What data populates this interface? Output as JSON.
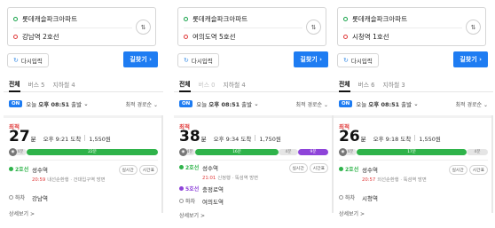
{
  "panels": [
    {
      "start": "롯데캐슬파크아파트",
      "end": "강남역 2호선",
      "reset_label": "다시입력",
      "go_label": "길찾기",
      "tabs": [
        {
          "label": "전체"
        },
        {
          "label": "버스 5"
        },
        {
          "label": "지하철 4"
        }
      ],
      "on_label": "ON",
      "departure_prefix": "오늘",
      "departure_time": "오후 08:51",
      "departure_suffix": "출발",
      "sort_label": "최적 경로순",
      "best_label": "최적",
      "duration": "27",
      "duration_unit": "분",
      "arrival": "오후 9:21 도착",
      "fare": "1,550원",
      "bar": [
        {
          "label": "4분",
          "kind": "walk"
        },
        {
          "label": "22분",
          "kind": "line2"
        }
      ],
      "legs": [
        {
          "line": "2호선",
          "line_color": "#2fb34a",
          "station": "성수역",
          "sub_time": "20:59",
          "sub_text": "내선순환행 · 건대입구역 방면",
          "btn1": "실시간",
          "btn2": "시간표"
        },
        {
          "line": "하차",
          "line_color": "#999999",
          "station": "강남역",
          "sub_time": "",
          "sub_text": ""
        }
      ],
      "more_label": "상세보기 >"
    },
    {
      "start": "롯데캐슬파크아파트",
      "end": "여의도역 5호선",
      "reset_label": "다시입력",
      "go_label": "길찾기",
      "tabs": [
        {
          "label": "전체"
        },
        {
          "label": "버스 0"
        },
        {
          "label": "지하철 4"
        }
      ],
      "on_label": "ON",
      "departure_prefix": "오늘",
      "departure_time": "오후 08:51",
      "departure_suffix": "출발",
      "sort_label": "최적 경로순",
      "best_label": "최적",
      "duration": "38",
      "duration_unit": "분",
      "arrival": "오후 9:34 도착",
      "fare": "1,750원",
      "bar": [
        {
          "label": "4분",
          "kind": "walk"
        },
        {
          "label": "16분",
          "kind": "line2"
        },
        {
          "label": "4분",
          "kind": "walk"
        },
        {
          "label": "9분",
          "kind": "line5"
        }
      ],
      "legs": [
        {
          "line": "2호선",
          "line_color": "#2fb34a",
          "station": "성수역",
          "sub_time": "21:01",
          "sub_text": "신정행 · 뚝섬역 방면",
          "btn1": "실시간",
          "btn2": "시간표"
        },
        {
          "line": "5호선",
          "line_color": "#8e44d9",
          "station": "충정로역",
          "sub_time": "",
          "sub_text": ""
        },
        {
          "line": "하차",
          "line_color": "#999999",
          "station": "여의도역",
          "sub_time": "",
          "sub_text": ""
        }
      ],
      "more_label": "상세보기 >"
    },
    {
      "start": "롯데캐슬파크아파트",
      "end": "시청역 1호선",
      "reset_label": "다시입력",
      "go_label": "길찾기",
      "tabs": [
        {
          "label": "전체"
        },
        {
          "label": "버스 6"
        },
        {
          "label": "지하철 3"
        }
      ],
      "on_label": "ON",
      "departure_prefix": "오늘",
      "departure_time": "오후 08:51",
      "departure_suffix": "출발",
      "sort_label": "최적 경로순",
      "best_label": "최적",
      "duration": "26",
      "duration_unit": "분",
      "arrival": "오후 9:18 도착",
      "fare": "1,550원",
      "bar": [
        {
          "label": "4분",
          "kind": "walk"
        },
        {
          "label": "17분",
          "kind": "line2"
        },
        {
          "label": "4분",
          "kind": "walk"
        }
      ],
      "legs": [
        {
          "line": "2호선",
          "line_color": "#2fb34a",
          "station": "성수역",
          "sub_time": "20:57",
          "sub_text": "외선순환행 · 뚝섬역 방면",
          "btn1": "실시간",
          "btn2": "시간표"
        },
        {
          "line": "하차",
          "line_color": "#999999",
          "station": "시청역",
          "sub_time": "",
          "sub_text": ""
        }
      ],
      "more_label": "상세보기 >"
    }
  ]
}
